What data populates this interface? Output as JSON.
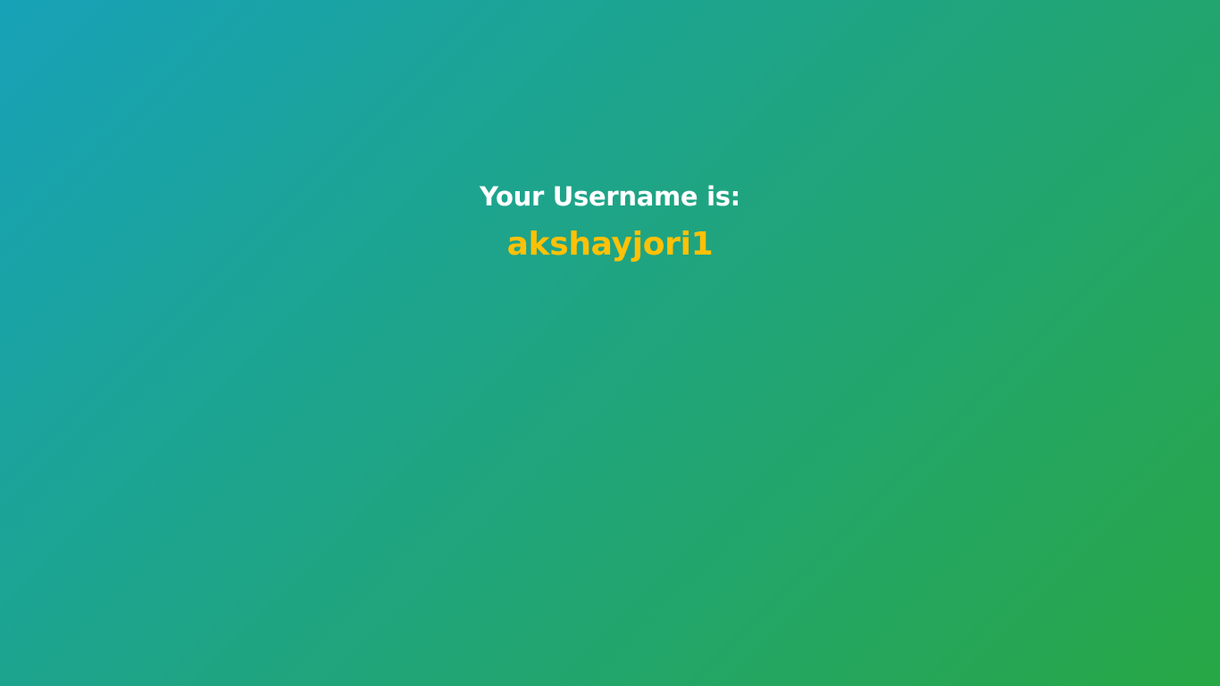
{
  "result": {
    "heading": "Your Username is:",
    "username": "akshayjori1"
  },
  "colors": {
    "gradient_start": "#17a2b8",
    "gradient_end": "#28a745",
    "heading_text": "#ffffff",
    "username_text": "#ffc107"
  }
}
